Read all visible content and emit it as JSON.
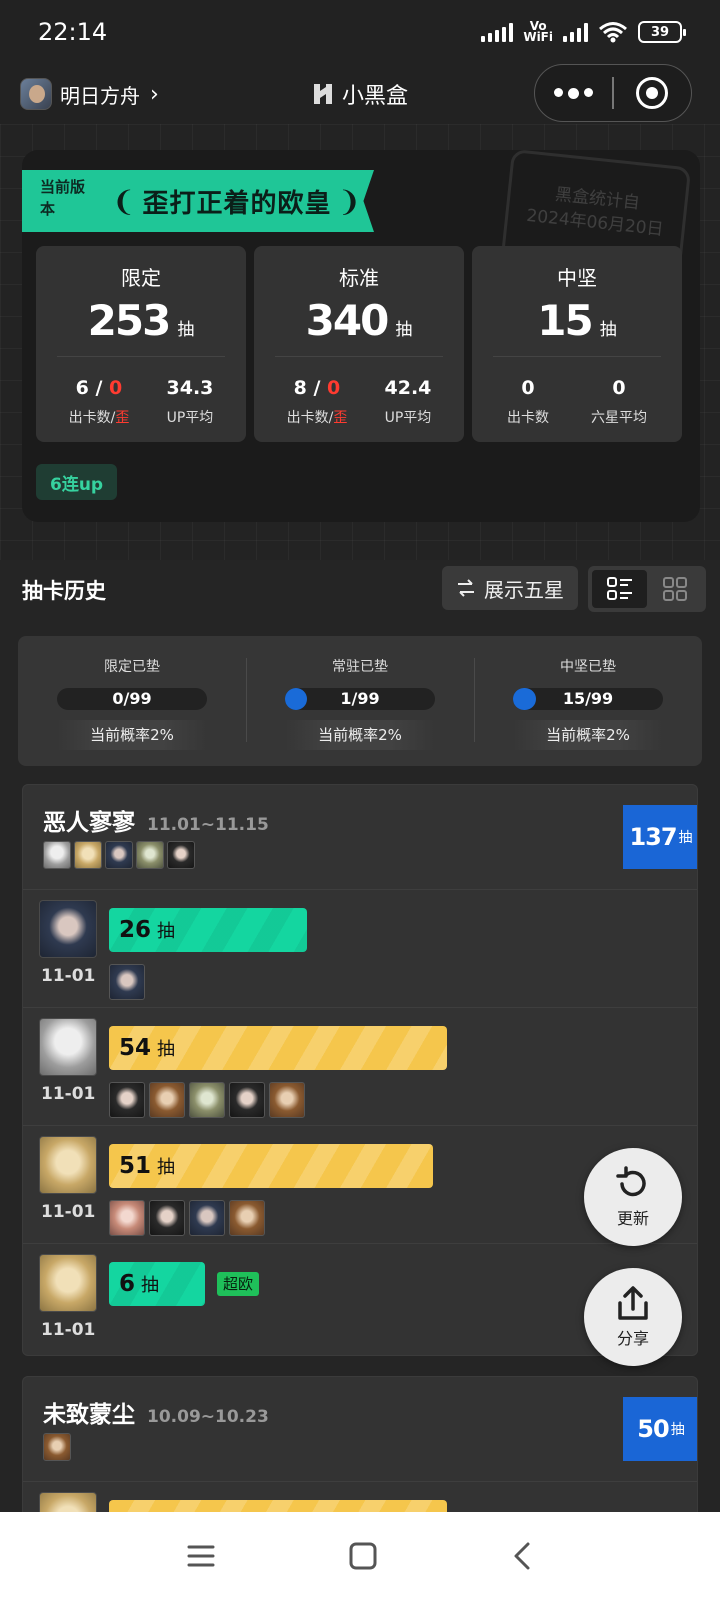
{
  "status_bar": {
    "time": "22:14",
    "battery": "39"
  },
  "app_bar": {
    "mini_program_name": "明日方舟",
    "title": "小黑盒"
  },
  "hero": {
    "version_tag": "当前版本",
    "version_title": "歪打正着的欧皇",
    "stamp_text": "黑盒统计自",
    "stamp_date": "2024年06月20日",
    "cards": [
      {
        "label": "限定",
        "count": "253",
        "unit": "抽",
        "sub1_a": "6",
        "sub1_sep": " / ",
        "sub1_b": "0",
        "sub1_cap_a": "出卡数",
        "sub1_cap_sep": "/",
        "sub1_cap_b": "歪",
        "sub2": "34.3",
        "sub2_cap": "UP平均"
      },
      {
        "label": "标准",
        "count": "340",
        "unit": "抽",
        "sub1_a": "8",
        "sub1_sep": " / ",
        "sub1_b": "0",
        "sub1_cap_a": "出卡数",
        "sub1_cap_sep": "/",
        "sub1_cap_b": "歪",
        "sub2": "42.4",
        "sub2_cap": "UP平均"
      },
      {
        "label": "中坚",
        "count": "15",
        "unit": "抽",
        "sub1_a": "0",
        "sub1_cap_a": "出卡数",
        "sub2": "0",
        "sub2_cap": "六星平均"
      }
    ],
    "badge": "6连up"
  },
  "history": {
    "title": "抽卡历史",
    "toggle_label": "展示五星",
    "pity": [
      {
        "label": "限定已垫",
        "value": "0/99",
        "fill": 0.0,
        "rate": "当前概率2%"
      },
      {
        "label": "常驻已垫",
        "value": "1/99",
        "fill": 0.0101,
        "rate": "当前概率2%"
      },
      {
        "label": "中坚已垫",
        "value": "15/99",
        "fill": 0.1515,
        "rate": "当前概率2%"
      }
    ],
    "groups": [
      {
        "name": "恶人寥寥",
        "date": "11.01~11.15",
        "total": "137",
        "total_unit": "抽",
        "pulls": [
          {
            "count": "26",
            "unit": "抽",
            "date": "11-01",
            "tag": ""
          },
          {
            "count": "54",
            "unit": "抽",
            "date": "11-01",
            "tag": ""
          },
          {
            "count": "51",
            "unit": "抽",
            "date": "11-01",
            "tag": ""
          },
          {
            "count": "6",
            "unit": "抽",
            "date": "11-01",
            "tag": "超欧"
          }
        ]
      },
      {
        "name": "未致蒙尘",
        "date": "10.09~10.23",
        "total": "50",
        "total_unit": "抽"
      }
    ]
  },
  "fabs": {
    "refresh": "更新",
    "share": "分享"
  }
}
